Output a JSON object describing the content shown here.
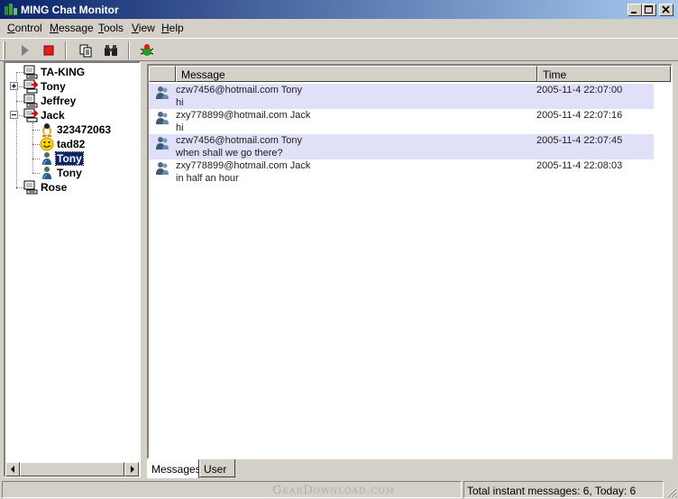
{
  "window": {
    "title": "MING Chat Monitor",
    "title_icon": "ming-logo-icon",
    "buttons": [
      "minimize-icon",
      "maximize-icon",
      "close-icon"
    ]
  },
  "menu": [
    {
      "label": "Control",
      "accel": "C"
    },
    {
      "label": "Message",
      "accel": "M"
    },
    {
      "label": "Tools",
      "accel": "T"
    },
    {
      "label": "View",
      "accel": "V"
    },
    {
      "label": "Help",
      "accel": "H"
    }
  ],
  "toolbar": {
    "tools": [
      "play-icon",
      "stop-icon",
      "copy-pages-icon",
      "binoculars-icon",
      "bug-icon"
    ]
  },
  "tree": {
    "nodes": [
      {
        "label": "TA-KING",
        "icon": "computer-icon",
        "expander": ""
      },
      {
        "label": "Tony",
        "icon": "computer-alert-icon",
        "expander": "+"
      },
      {
        "label": "Jeffrey",
        "icon": "computer-icon",
        "expander": ""
      },
      {
        "label": "Jack",
        "icon": "computer-alert-icon",
        "expander": "-"
      },
      {
        "label": "323472063",
        "icon": "qq-penguin-icon",
        "expander": ""
      },
      {
        "label": "tad82",
        "icon": "yahoo-smiley-icon",
        "expander": ""
      },
      {
        "label": "Tony",
        "icon": "msn-user-icon",
        "expander": "",
        "selected": true
      },
      {
        "label": "Tony",
        "icon": "msn-user-icon",
        "expander": ""
      },
      {
        "label": "Rose",
        "icon": "computer-icon",
        "expander": ""
      }
    ]
  },
  "messages": {
    "columns": [
      "Message",
      "Time"
    ],
    "rows": [
      {
        "from": "czw7456@hotmail.com Tony",
        "text": "hi",
        "time": "2005-11-4 22:07:00",
        "icon": "msn-message-icon"
      },
      {
        "from": "zxy778899@hotmail.com Jack",
        "text": "hi",
        "time": "2005-11-4 22:07:16",
        "icon": "msn-message-icon"
      },
      {
        "from": "czw7456@hotmail.com Tony",
        "text": "when shall we go there?",
        "time": "2005-11-4 22:07:45",
        "icon": "msn-message-icon"
      },
      {
        "from": "zxy778899@hotmail.com Jack",
        "text": "in half an hour",
        "time": "2005-11-4 22:08:03",
        "icon": "msn-message-icon"
      }
    ]
  },
  "tabs": [
    {
      "label": "Messages",
      "active": true
    },
    {
      "label": "User",
      "active": false
    }
  ],
  "status": {
    "left": "",
    "watermark": "GearDownload.com",
    "right": "Total instant messages: 6, Today: 6"
  },
  "colors": {
    "title_start": "#0a246a",
    "title_end": "#a6caf0",
    "row_highlight": "#e0e0f8",
    "face": "#d4d0c8"
  }
}
